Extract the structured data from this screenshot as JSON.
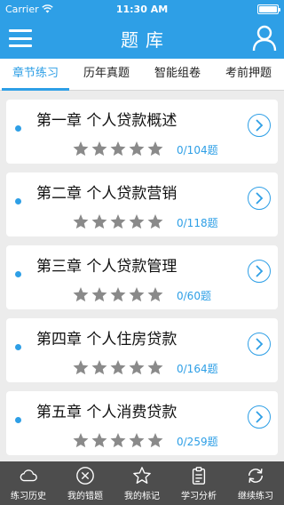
{
  "status": {
    "carrier": "Carrier",
    "time": "11:30 AM",
    "battery_level": 1.0
  },
  "header": {
    "title": "题库",
    "menu_icon": "menu-icon",
    "user_icon": "user-icon"
  },
  "tabs": [
    {
      "label": "章节练习",
      "active": true
    },
    {
      "label": "历年真题",
      "active": false
    },
    {
      "label": "智能组卷",
      "active": false
    },
    {
      "label": "考前押题",
      "active": false
    }
  ],
  "chapters": [
    {
      "title": "第一章 个人贷款概述",
      "progress": "0/104题",
      "rating": 0
    },
    {
      "title": "第二章 个人贷款营销",
      "progress": "0/118题",
      "rating": 0
    },
    {
      "title": "第三章 个人贷款管理",
      "progress": "0/60题",
      "rating": 0
    },
    {
      "title": "第四章 个人住房贷款",
      "progress": "0/164题",
      "rating": 0
    },
    {
      "title": "第五章 个人消费贷款",
      "progress": "0/259题",
      "rating": 0
    }
  ],
  "bottom_nav": [
    {
      "label": "练习历史",
      "icon": "cloud-icon"
    },
    {
      "label": "我的错题",
      "icon": "close-circle-icon"
    },
    {
      "label": "我的标记",
      "icon": "star-outline-icon"
    },
    {
      "label": "学习分析",
      "icon": "clipboard-icon"
    },
    {
      "label": "继续练习",
      "icon": "refresh-icon"
    }
  ],
  "colors": {
    "accent": "#2e9fe6",
    "star_inactive": "#8a8a8a",
    "tabbar": "#4d4d4d",
    "background": "#ececec"
  }
}
